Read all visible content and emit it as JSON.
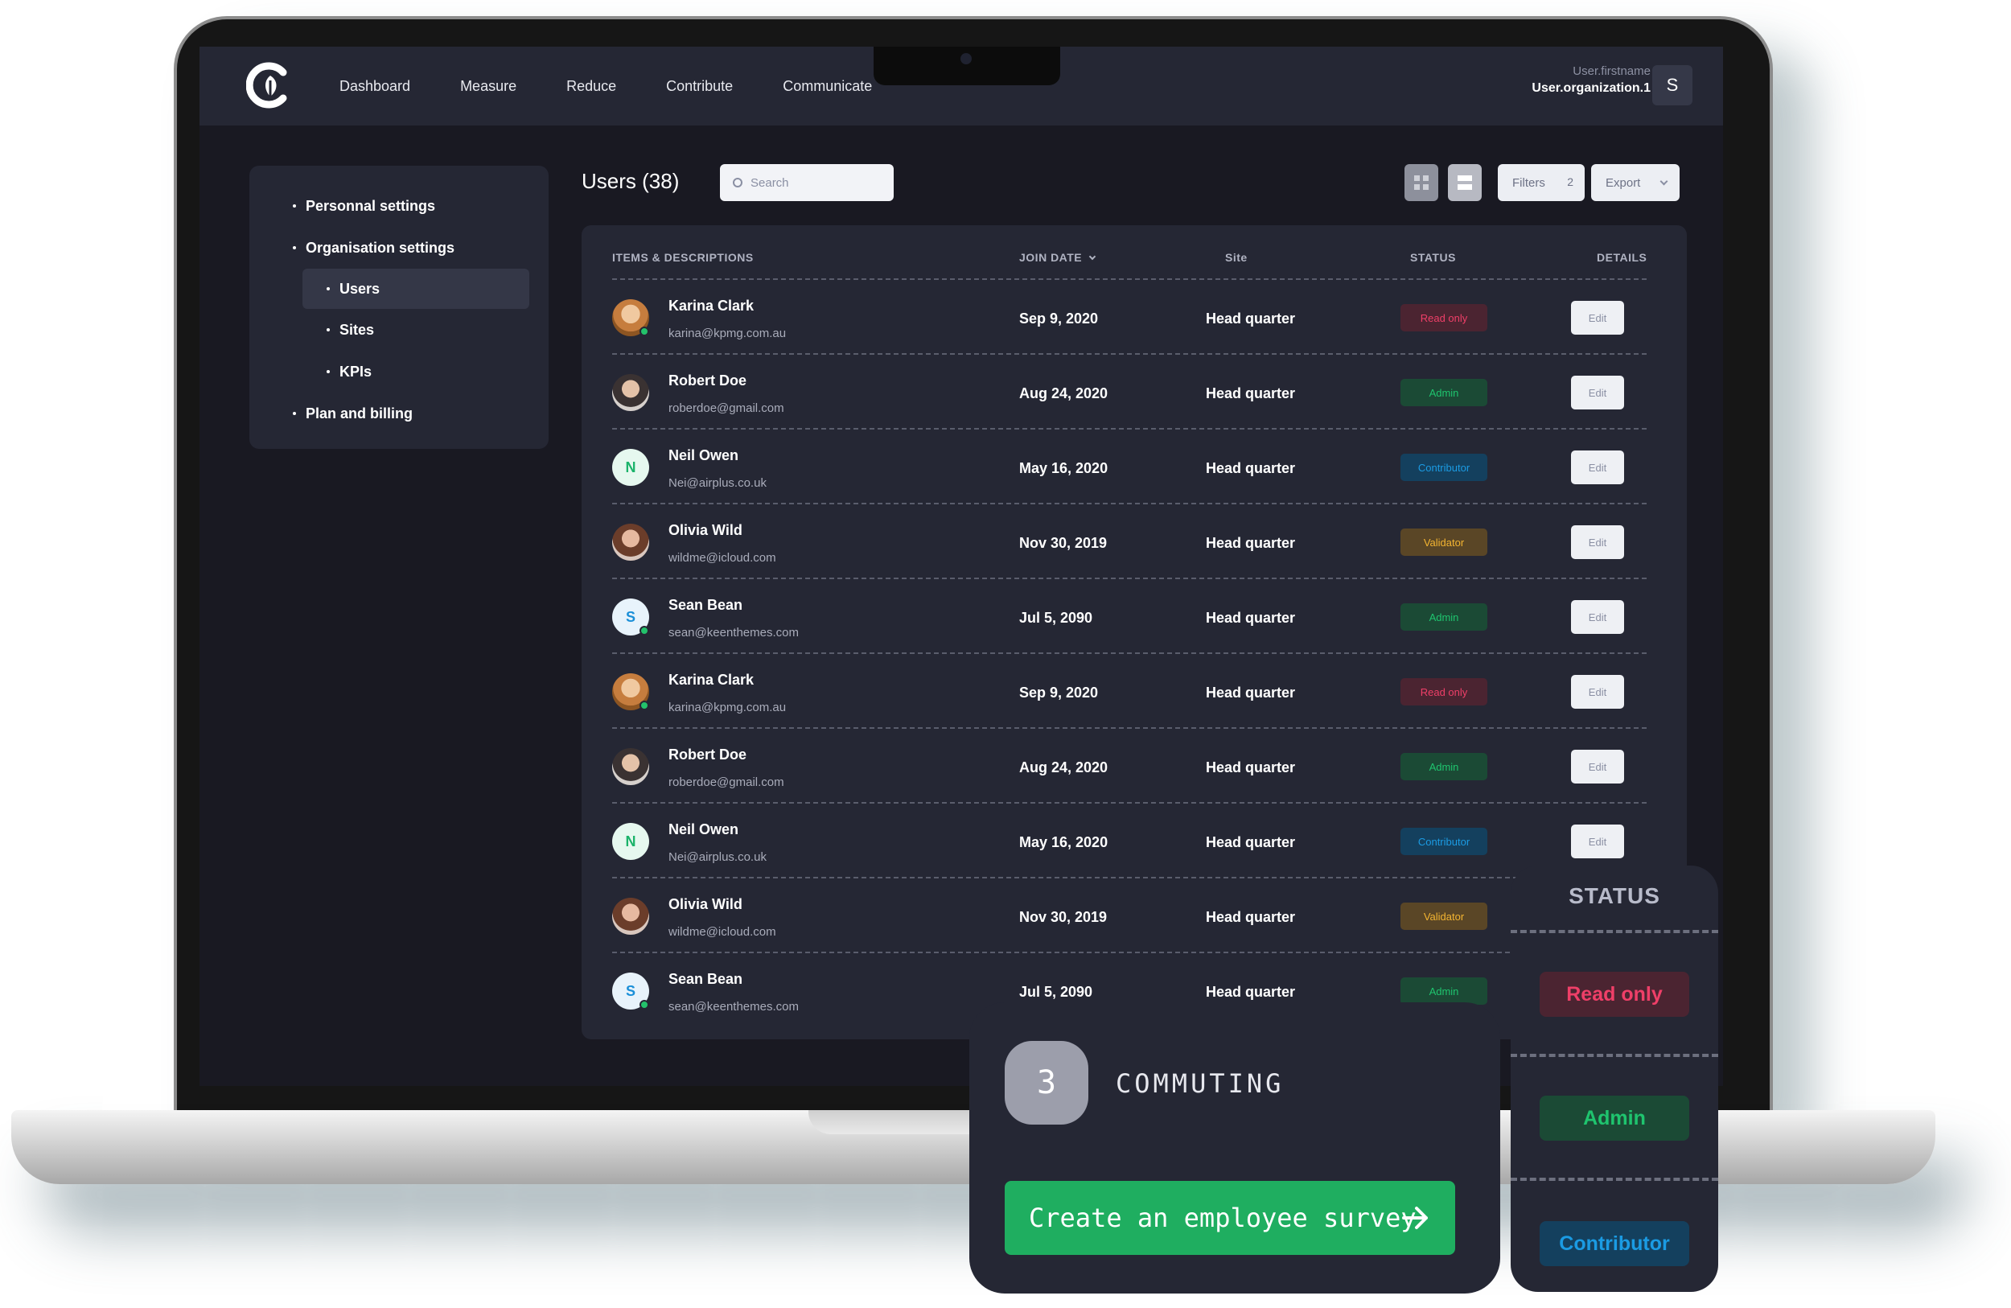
{
  "header": {
    "nav": [
      "Dashboard",
      "Measure",
      "Reduce",
      "Contribute",
      "Communicate"
    ],
    "user_firstname": "User.firstname",
    "user_org": "User.organization.1",
    "avatar_letter": "S"
  },
  "sidebar": {
    "items": [
      {
        "label": "Personnal settings",
        "level": 1
      },
      {
        "label": "Organisation settings",
        "level": 1
      },
      {
        "label": "Users",
        "level": 2,
        "active": true
      },
      {
        "label": "Sites",
        "level": 2
      },
      {
        "label": "KPIs",
        "level": 2
      },
      {
        "label": "Plan and billing",
        "level": 1
      }
    ]
  },
  "main": {
    "title": "Users (38)",
    "search_placeholder": "Search",
    "filters_label": "Filters",
    "filters_count": "2",
    "export_label": "Export"
  },
  "table": {
    "columns": {
      "items": "ITEMS & DESCRIPTIONS",
      "join_date": "JOIN DATE",
      "site": "Site",
      "status": "STATUS",
      "details": "DETAILS"
    },
    "edit_label": "Edit",
    "rows": [
      {
        "name": "Karina Clark",
        "email": "karina@kpmg.com.au",
        "date": "Sep 9, 2020",
        "site": "Head quarter",
        "status": "Read only",
        "status_type": "readonly",
        "avatar": "photo1",
        "online": true
      },
      {
        "name": "Robert Doe",
        "email": "roberdoe@gmail.com",
        "date": "Aug 24, 2020",
        "site": "Head quarter",
        "status": "Admin",
        "status_type": "admin",
        "avatar": "photo2",
        "online": false
      },
      {
        "name": "Neil Owen",
        "email": "Nei@airplus.co.uk",
        "date": "May 16, 2020",
        "site": "Head quarter",
        "status": "Contributor",
        "status_type": "contributor",
        "avatar": "N",
        "avatar_color": "green",
        "online": false
      },
      {
        "name": "Olivia Wild",
        "email": "wildme@icloud.com",
        "date": "Nov 30, 2019",
        "site": "Head quarter",
        "status": "Validator",
        "status_type": "validator",
        "avatar": "photo3",
        "online": false
      },
      {
        "name": "Sean Bean",
        "email": "sean@keenthemes.com",
        "date": "Jul 5, 2090",
        "site": "Head quarter",
        "status": "Admin",
        "status_type": "admin",
        "avatar": "S",
        "avatar_color": "blue",
        "online": true
      },
      {
        "name": "Karina Clark",
        "email": "karina@kpmg.com.au",
        "date": "Sep 9, 2020",
        "site": "Head quarter",
        "status": "Read only",
        "status_type": "readonly",
        "avatar": "photo1",
        "online": true
      },
      {
        "name": "Robert Doe",
        "email": "roberdoe@gmail.com",
        "date": "Aug 24, 2020",
        "site": "Head quarter",
        "status": "Admin",
        "status_type": "admin",
        "avatar": "photo2",
        "online": false
      },
      {
        "name": "Neil Owen",
        "email": "Nei@airplus.co.uk",
        "date": "May 16, 2020",
        "site": "Head quarter",
        "status": "Contributor",
        "status_type": "contributor",
        "avatar": "N",
        "avatar_color": "green",
        "online": false
      },
      {
        "name": "Olivia Wild",
        "email": "wildme@icloud.com",
        "date": "Nov 30, 2019",
        "site": "Head quarter",
        "status": "Validator",
        "status_type": "validator",
        "avatar": "photo3",
        "online": false
      },
      {
        "name": "Sean Bean",
        "email": "sean@keenthemes.com",
        "date": "Jul 5, 2090",
        "site": "Head quarter",
        "status": "Admin",
        "status_type": "admin",
        "avatar": "S",
        "avatar_color": "blue",
        "online": true
      }
    ]
  },
  "status_card": {
    "title": "STATUS",
    "badges": [
      {
        "label": "Read only",
        "type": "readonly"
      },
      {
        "label": "Admin",
        "type": "admin"
      },
      {
        "label": "Contributor",
        "type": "contributor"
      }
    ]
  },
  "commute_card": {
    "number": "3",
    "label": "COMMUTING",
    "cta": "Create an employee survey"
  },
  "colors": {
    "screen_bg": "#191922",
    "panel_bg": "#252734",
    "accent_green": "#1fae60",
    "read_only": "#ef3f68",
    "admin": "#1fc46e",
    "contributor": "#1b9be3",
    "validator": "#f3b431"
  }
}
